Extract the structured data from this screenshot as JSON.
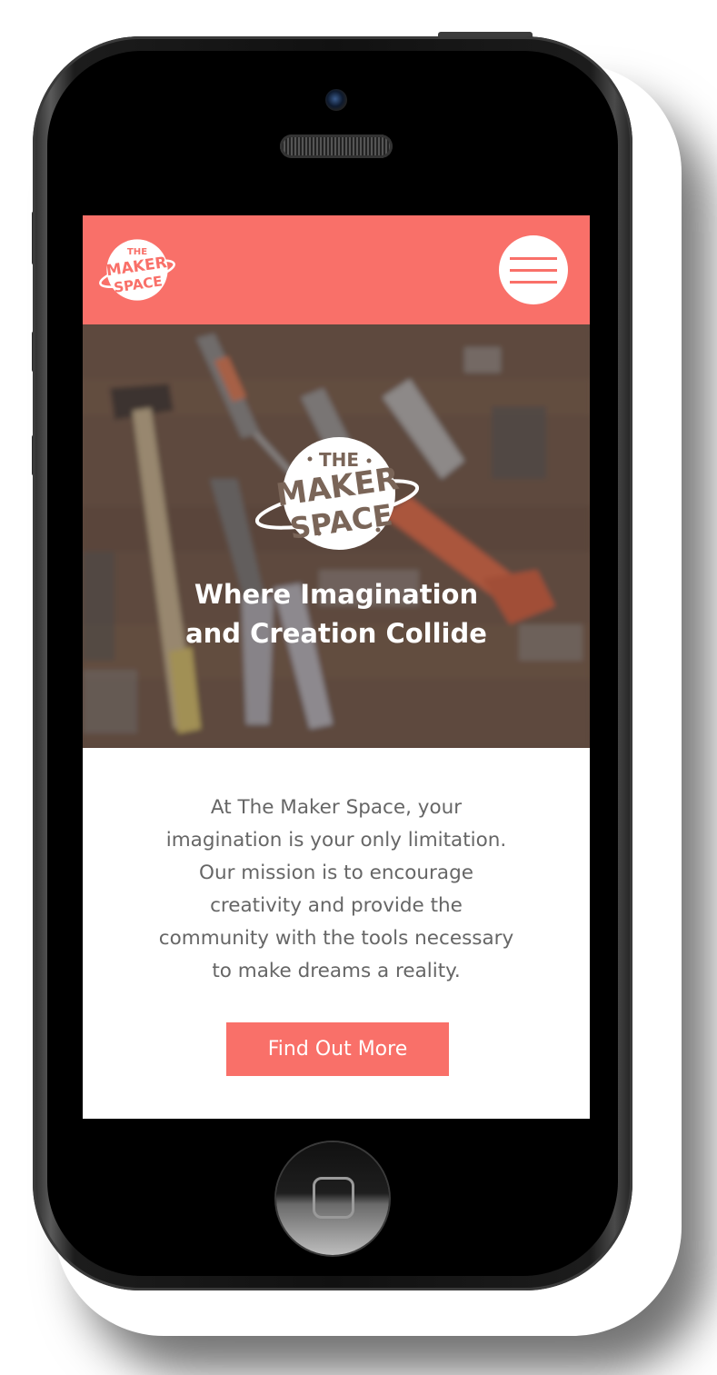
{
  "brand": {
    "logo_line1": "THE",
    "logo_line2": "MAKER",
    "logo_line3": "SPACE"
  },
  "colors": {
    "accent": "#f97069",
    "text": "#666666",
    "background": "#ffffff"
  },
  "navbar": {
    "menu_icon": "hamburger-icon"
  },
  "hero": {
    "title_line1": "Where Imagination",
    "title_line2": "and Creation Collide"
  },
  "mission": {
    "lines": [
      "At The Maker Space, your",
      "imagination is your only limitation.",
      "Our mission is to encourage",
      "creativity and provide the",
      "community with the tools necessary",
      "to make dreams a reality."
    ]
  },
  "cta": {
    "label": "Find Out More"
  }
}
